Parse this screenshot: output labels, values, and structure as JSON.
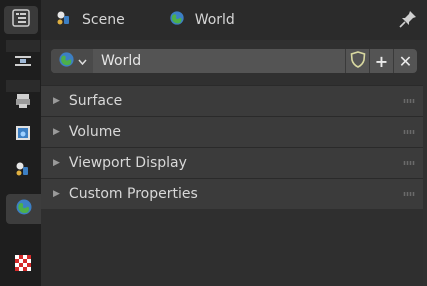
{
  "header": {
    "crumbs": [
      {
        "label": "Scene",
        "icon": "scene-icon"
      },
      {
        "label": "World",
        "icon": "world-icon"
      }
    ],
    "pin_icon": "pin-icon"
  },
  "tabs": [
    {
      "name": "editor-type-tab",
      "icon": "properties-editor-icon"
    },
    {
      "name": "tab-tool",
      "icon": "tool-icon"
    },
    {
      "name": "tab-render",
      "icon": "render-icon"
    },
    {
      "name": "tab-output",
      "icon": "output-icon"
    },
    {
      "name": "tab-scene",
      "icon": "scene-icon"
    },
    {
      "name": "tab-world",
      "icon": "world-icon",
      "active": true
    },
    {
      "name": "tab-texture",
      "icon": "texture-icon"
    }
  ],
  "datablock": {
    "name": "World",
    "fake_user_icon": "shield-icon",
    "new_label": "+",
    "unlink_label": "✕"
  },
  "sections": [
    {
      "label": "Surface"
    },
    {
      "label": "Volume"
    },
    {
      "label": "Viewport Display"
    },
    {
      "label": "Custom Properties"
    }
  ],
  "colors": {
    "accent_blue": "#3c7fc4",
    "world_green": "#4db04a",
    "scene_yellow": "#e0b040",
    "texture_red": "#d42a2a"
  }
}
